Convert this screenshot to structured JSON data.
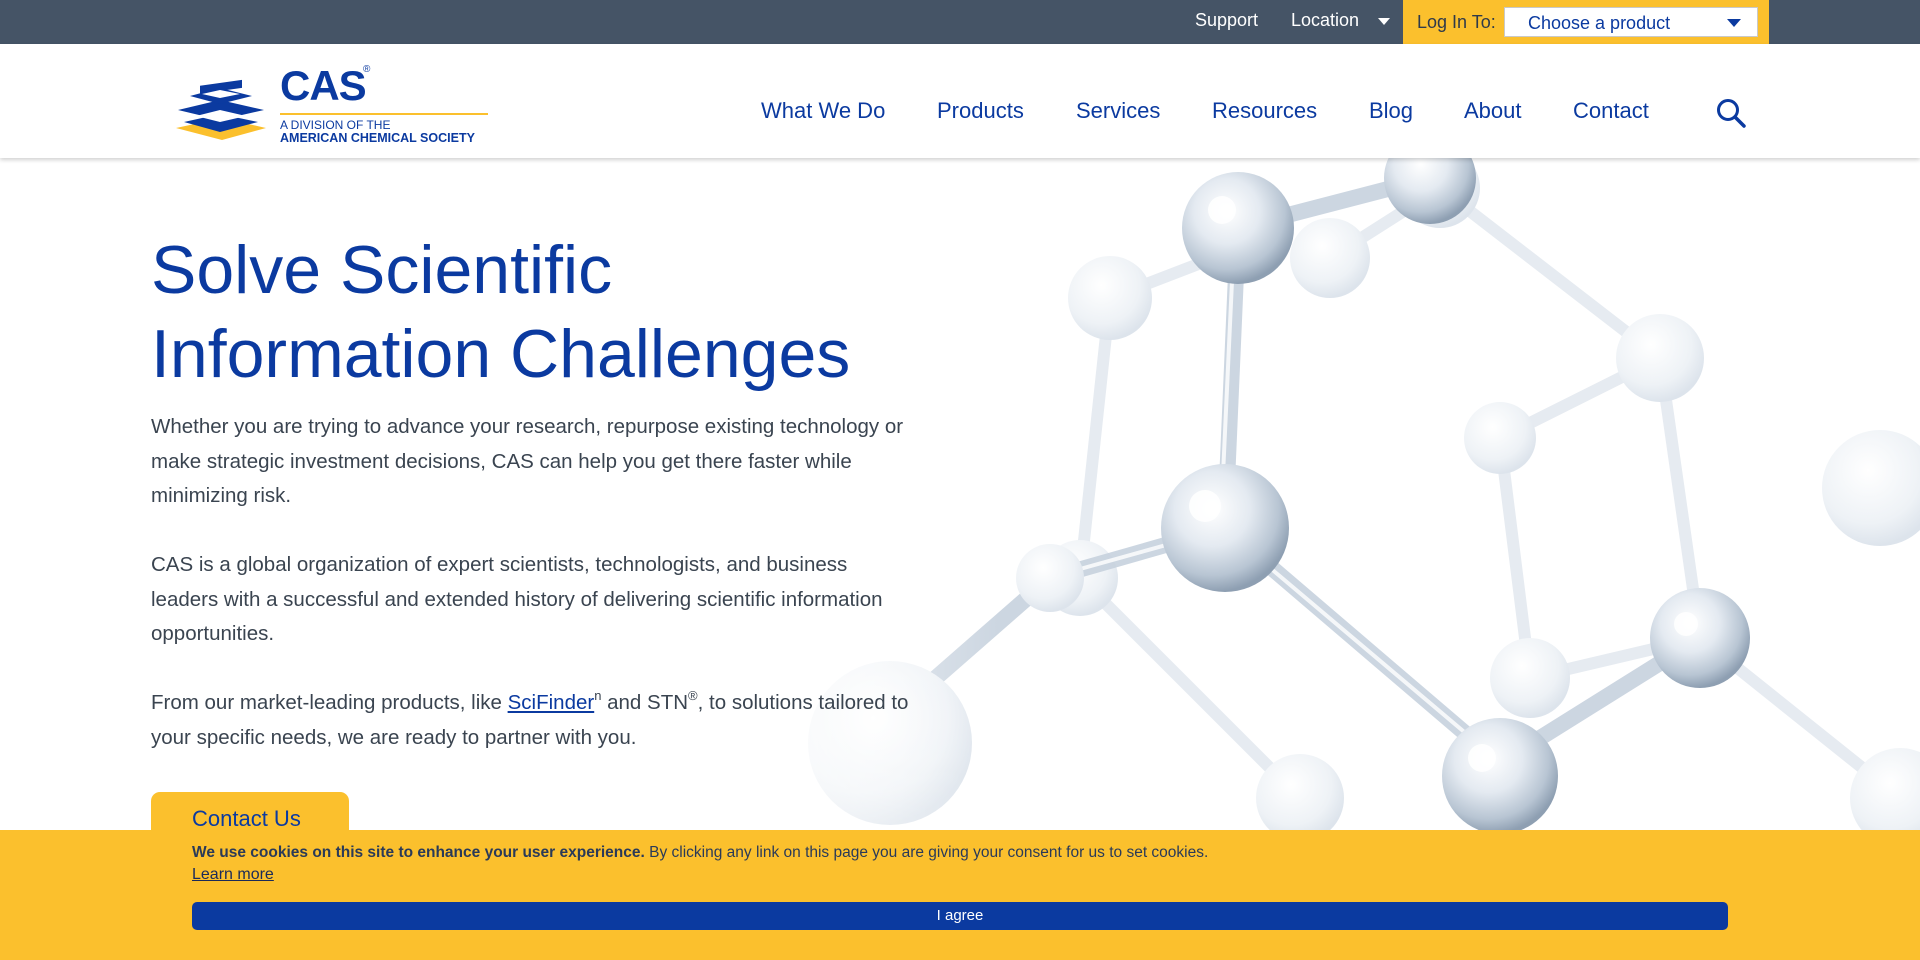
{
  "colors": {
    "brand_blue": "#0b3aa0",
    "brand_yellow": "#fbc02d",
    "utility_bar": "#455466",
    "body_text": "#3a4450"
  },
  "utility_bar": {
    "support_label": "Support",
    "location_label": "Location",
    "login_label": "Log In To:",
    "product_select_value": "Choose a product"
  },
  "logo": {
    "word": "CAS",
    "registered": "®",
    "sub_line_1": "A DIVISION OF THE",
    "sub_line_2": "AMERICAN CHEMICAL SOCIETY"
  },
  "nav": {
    "items": [
      {
        "label": "What We Do"
      },
      {
        "label": "Products"
      },
      {
        "label": "Services"
      },
      {
        "label": "Resources"
      },
      {
        "label": "Blog"
      },
      {
        "label": "About"
      },
      {
        "label": "Contact"
      }
    ],
    "search_icon": "search-icon"
  },
  "hero": {
    "title_line_1": "Solve Scientific",
    "title_line_2": "Information Challenges",
    "para_1": "Whether you are trying to advance your research, repurpose existing technology or make strategic investment decisions, CAS can help you get there faster while minimizing risk.",
    "para_2": "CAS is a global organization of expert scientists, technologists, and business leaders with a successful and extended history of delivering scientific information opportunities.",
    "para_3_start": "From our market-leading products, like ",
    "para_3_link": "SciFinder",
    "para_3_link_sup": "n",
    "para_3_mid": " and STN",
    "para_3_mid_sup": "®",
    "para_3_end": ", to solutions tailored to your specific needs, we are ready to partner with you.",
    "cta_label": "Contact Us"
  },
  "cookie": {
    "bold_text": "We use cookies on this site to enhance your user experience.",
    "text": " By clicking any link on this page you are giving your consent for us to set cookies.",
    "learn_more": "Learn more",
    "agree_label": "I agree"
  }
}
